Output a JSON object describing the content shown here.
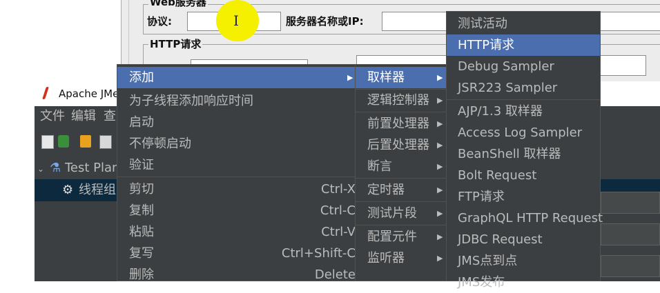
{
  "http_panel": {
    "section_web_server": "Web服务器",
    "protocol_label": "协议:",
    "server_label": "服务器名称或IP:",
    "section_http_request": "HTTP请求"
  },
  "window": {
    "title": "Apache JMe",
    "menu": [
      "文件",
      "编辑",
      "查"
    ],
    "tree": [
      {
        "label": "Test Plan",
        "icon": "flask-icon",
        "selected": false
      },
      {
        "label": "线程组",
        "icon": "gear-icon",
        "selected": true
      }
    ]
  },
  "menu_level1": {
    "items": [
      {
        "label": "添加",
        "submenu": true,
        "highlighted": true
      },
      {
        "label": "为子线程添加响应时间"
      },
      {
        "label": "启动"
      },
      {
        "label": "不停顿启动"
      },
      {
        "label": "验证"
      },
      {
        "label": "剪切",
        "shortcut": "Ctrl-X"
      },
      {
        "label": "复制",
        "shortcut": "Ctrl-C"
      },
      {
        "label": "粘贴",
        "shortcut": "Ctrl-V"
      },
      {
        "label": "复写",
        "shortcut": "Ctrl+Shift-C"
      },
      {
        "label": "删除",
        "shortcut": "Delete"
      }
    ]
  },
  "menu_level2": {
    "items": [
      {
        "label": "取样器",
        "submenu": true,
        "highlighted": true
      },
      {
        "label": "逻辑控制器",
        "submenu": true
      },
      {
        "label": "前置处理器",
        "submenu": true
      },
      {
        "label": "后置处理器",
        "submenu": true
      },
      {
        "label": "断言",
        "submenu": true
      },
      {
        "label": "定时器",
        "submenu": true
      },
      {
        "label": "测试片段",
        "submenu": true
      },
      {
        "label": "配置元件",
        "submenu": true
      },
      {
        "label": "监听器",
        "submenu": true
      }
    ]
  },
  "menu_level3": {
    "items": [
      {
        "label": "测试活动"
      },
      {
        "label": "HTTP请求",
        "highlighted": true
      },
      {
        "label": "Debug Sampler"
      },
      {
        "label": "JSR223 Sampler"
      },
      {
        "label": "AJP/1.3 取样器"
      },
      {
        "label": "Access Log Sampler"
      },
      {
        "label": "BeanShell 取样器"
      },
      {
        "label": "Bolt Request"
      },
      {
        "label": "FTP请求"
      },
      {
        "label": "GraphQL HTTP Request"
      },
      {
        "label": "JDBC Request"
      },
      {
        "label": "JMS点到点"
      },
      {
        "label": "JMS发布"
      }
    ]
  },
  "colors": {
    "menu_bg": "#3c3f41",
    "menu_text": "#bbbbbb",
    "highlight": "#4b6eaf",
    "cursor_highlight": "#f4f000"
  }
}
